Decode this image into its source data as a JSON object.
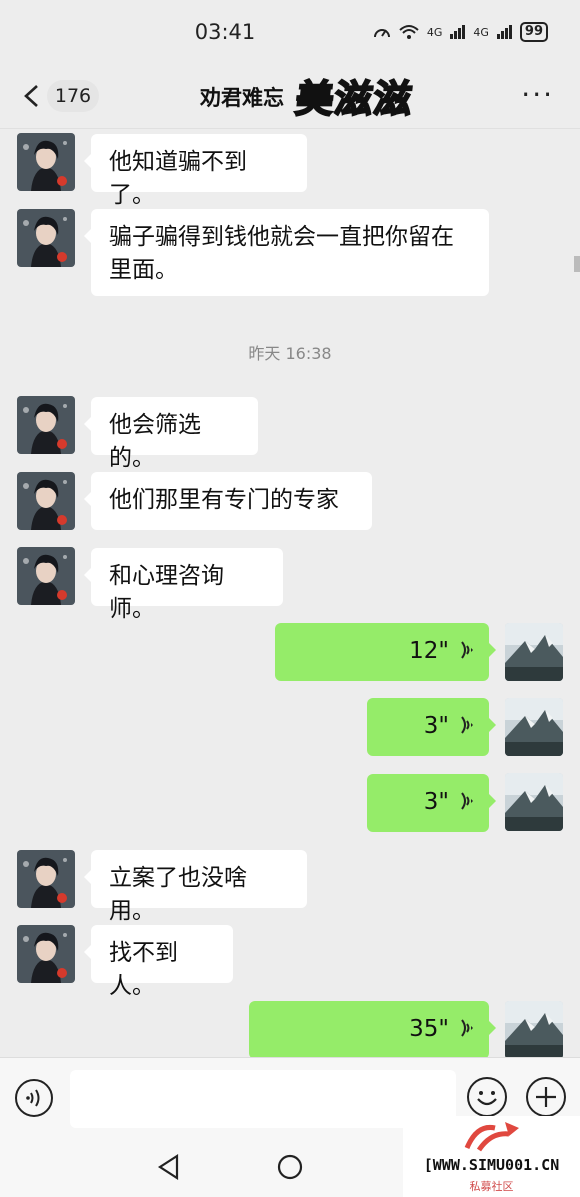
{
  "status_bar": {
    "time": "03:41",
    "battery": "99",
    "network_1": "4G",
    "network_2": "4G"
  },
  "header": {
    "unread_count": "176",
    "title": "劝君难忘",
    "sticker_text": "美滋滋",
    "more": "···"
  },
  "messages": [
    {
      "side": "left",
      "type": "text",
      "text": "他知道骗不到了。"
    },
    {
      "side": "left",
      "type": "text",
      "text": "骗子骗得到钱他就会一直把你留在里面。"
    },
    {
      "type": "timestamp",
      "text": "昨天 16:38"
    },
    {
      "side": "left",
      "type": "text",
      "text": "他会筛选的。"
    },
    {
      "side": "left",
      "type": "text",
      "text": "他们那里有专门的专家"
    },
    {
      "side": "left",
      "type": "text",
      "text": "和心理咨询师。"
    },
    {
      "side": "right",
      "type": "voice",
      "duration": "12\""
    },
    {
      "side": "right",
      "type": "voice",
      "duration": "3\""
    },
    {
      "side": "right",
      "type": "voice",
      "duration": "3\""
    },
    {
      "side": "left",
      "type": "text",
      "text": "立案了也没啥用。"
    },
    {
      "side": "left",
      "type": "text",
      "text": "找不到人。"
    },
    {
      "side": "right",
      "type": "voice",
      "duration": "35\""
    }
  ],
  "watermark": {
    "site": "WWW.SIMU001.CN",
    "sub": "私募社区",
    "bracket": "["
  },
  "colors": {
    "outgoing_bubble": "#95ec69",
    "incoming_bubble": "#ffffff",
    "background": "#ededed",
    "sticker": "#e8241c"
  },
  "icons": {
    "back": "chevron-left-icon",
    "more": "more-icon",
    "voice_wave": "voice-wave-icon",
    "voice_toggle": "voice-mode-icon",
    "emoji": "emoji-icon",
    "plus": "plus-icon",
    "nav_back": "triangle-back-icon",
    "nav_home": "circle-home-icon"
  }
}
